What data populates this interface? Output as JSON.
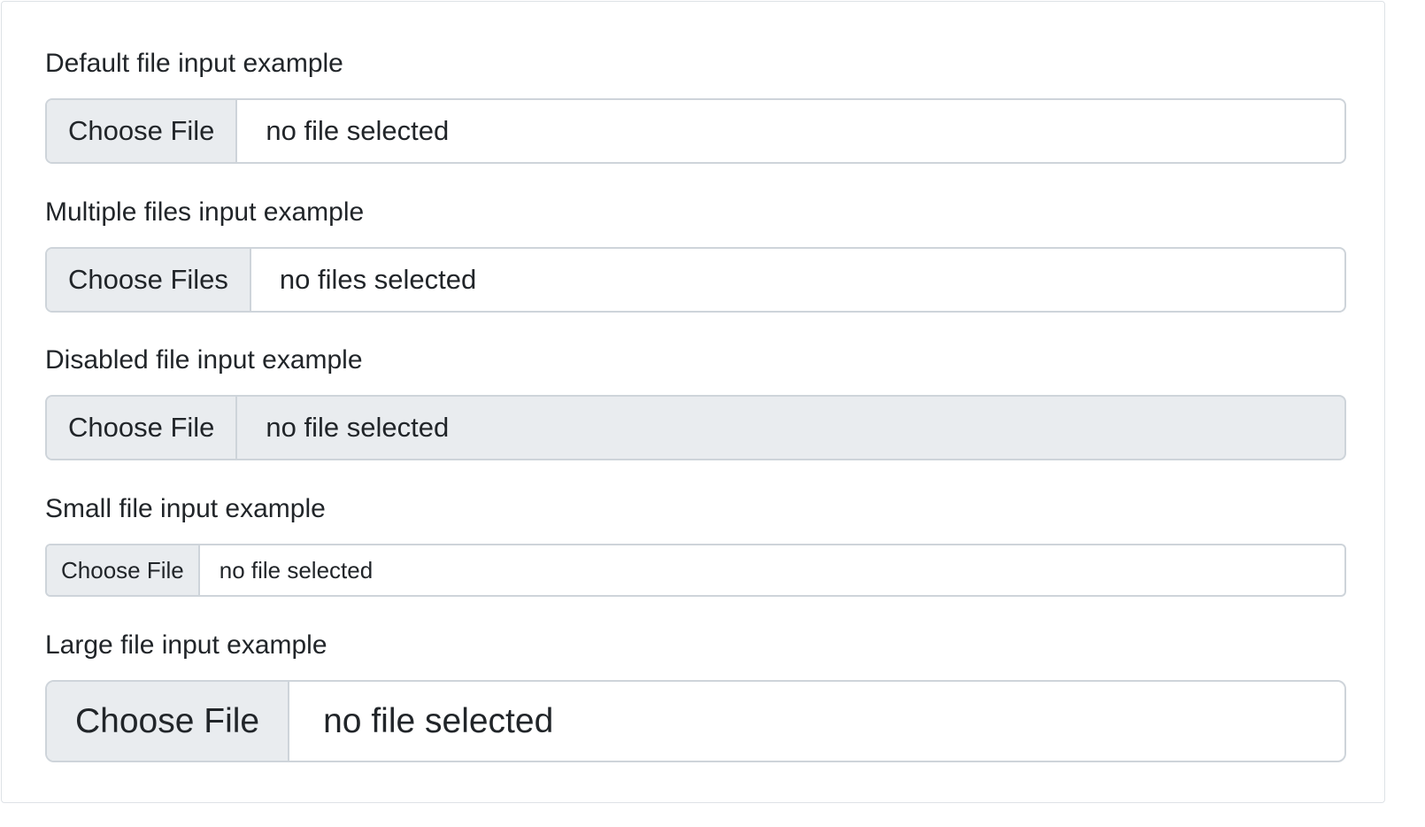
{
  "form": {
    "default": {
      "label": "Default file input example",
      "button": "Choose File",
      "status": "no file selected",
      "disabled": false
    },
    "multiple": {
      "label": "Multiple files input example",
      "button": "Choose Files",
      "status": "no files selected",
      "disabled": false
    },
    "disabled": {
      "label": "Disabled file input example",
      "button": "Choose File",
      "status": "no file selected",
      "disabled": true
    },
    "small": {
      "label": "Small file input example",
      "button": "Choose File",
      "status": "no file selected",
      "disabled": false
    },
    "large": {
      "label": "Large file input example",
      "button": "Choose File",
      "status": "no file selected",
      "disabled": false
    }
  },
  "colors": {
    "border": "#ced4da",
    "button_bg": "#e9ecef",
    "disabled_bg": "#e9ecef",
    "text": "#212529"
  }
}
